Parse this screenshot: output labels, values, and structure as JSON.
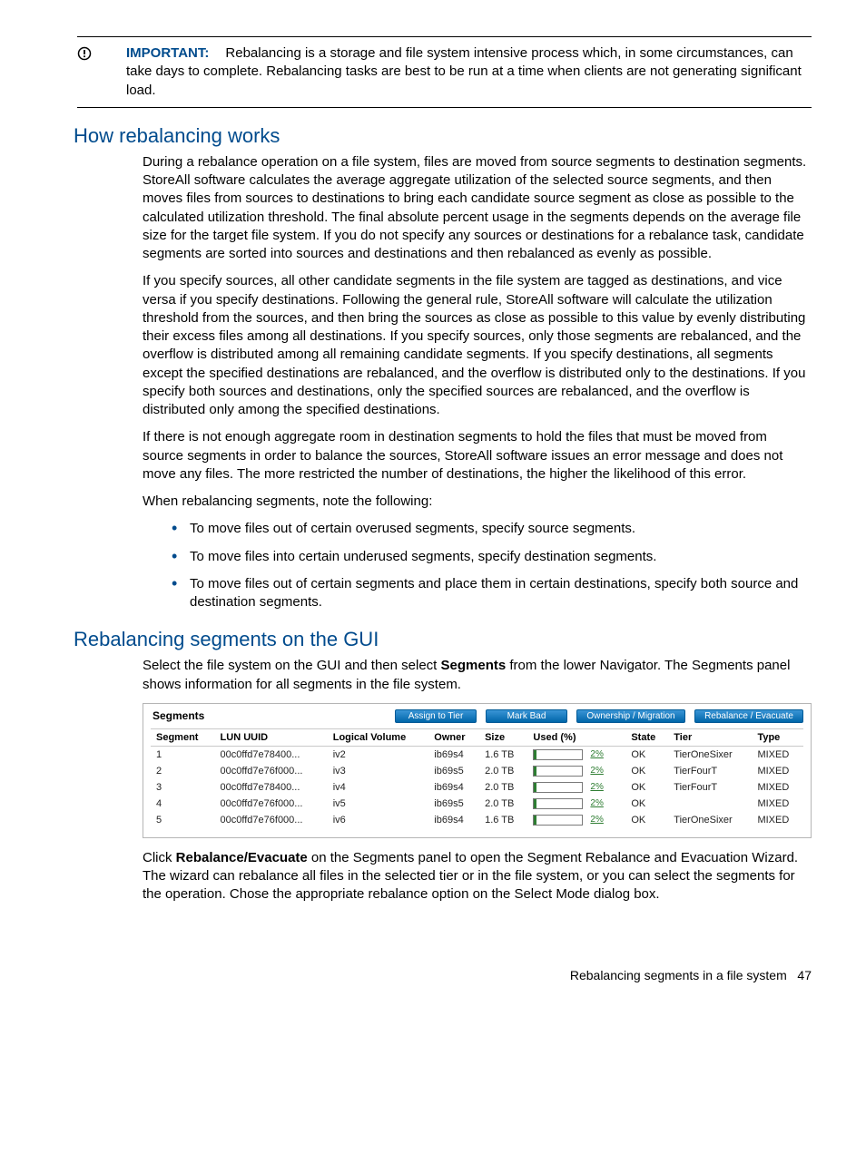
{
  "important": {
    "label": "IMPORTANT:",
    "text": "Rebalancing is a storage and file system intensive process which, in some circumstances, can take days to complete. Rebalancing tasks are best to be run at a time when clients are not generating significant load."
  },
  "section1": {
    "heading": "How rebalancing works",
    "p1": "During a rebalance operation on a file system, files are moved from source segments to destination segments. StoreAll software calculates the average aggregate utilization of the selected source segments, and then moves files from sources to destinations to bring each candidate source segment as close as possible to the calculated utilization threshold. The final absolute percent usage in the segments depends on the average file size for the target file system. If you do not specify any sources or destinations for a rebalance task, candidate segments are sorted into sources and destinations and then rebalanced as evenly as possible.",
    "p2": "If you specify sources, all other candidate segments in the file system are tagged as destinations, and vice versa if you specify destinations. Following the general rule, StoreAll software will calculate the utilization threshold from the sources, and then bring the sources as close as possible to this value by evenly distributing their excess files among all destinations. If you specify sources, only those segments are rebalanced, and the overflow is distributed among all remaining candidate segments. If you specify destinations, all segments except the specified destinations are rebalanced, and the overflow is distributed only to the destinations. If you specify both sources and destinations, only the specified sources are rebalanced, and the overflow is distributed only among the specified destinations.",
    "p3": "If there is not enough aggregate room in destination segments to hold the files that must be moved from source segments in order to balance the sources, StoreAll software issues an error message and does not move any files. The more restricted the number of destinations, the higher the likelihood of this error.",
    "p4": "When rebalancing segments, note the following:",
    "bullets": [
      "To move files out of certain overused segments, specify source segments.",
      "To move files into certain underused segments, specify destination segments.",
      "To move files out of certain segments and place them in certain destinations, specify both source and destination segments."
    ]
  },
  "section2": {
    "heading": "Rebalancing segments on the GUI",
    "p1_pre": "Select the file system on the GUI and then select ",
    "p1_bold": "Segments",
    "p1_post": " from the lower Navigator. The Segments panel shows information for all segments in the file system.",
    "p2_pre": "Click ",
    "p2_bold": "Rebalance/Evacuate",
    "p2_post": " on the Segments panel to open the Segment Rebalance and Evacuation Wizard. The wizard can rebalance all files in the selected tier or in the file system, or you can select the segments for the operation. Chose the appropriate rebalance option on the Select Mode dialog box."
  },
  "panel": {
    "title": "Segments",
    "buttons": [
      "Assign to Tier",
      "Mark Bad",
      "Ownership / Migration",
      "Rebalance / Evacuate"
    ],
    "columns": [
      "Segment",
      "LUN UUID",
      "Logical Volume",
      "Owner",
      "Size",
      "Used (%)",
      "State",
      "Tier",
      "Type"
    ],
    "rows": [
      {
        "segment": "1",
        "lun": "00c0ffd7e78400...",
        "lvol": "iv2",
        "owner": "ib69s4",
        "size": "1.6 TB",
        "used": "2%",
        "state": "OK",
        "tier": "TierOneSixer",
        "type": "MIXED"
      },
      {
        "segment": "2",
        "lun": "00c0ffd7e76f000...",
        "lvol": "iv3",
        "owner": "ib69s5",
        "size": "2.0 TB",
        "used": "2%",
        "state": "OK",
        "tier": "TierFourT",
        "type": "MIXED"
      },
      {
        "segment": "3",
        "lun": "00c0ffd7e78400...",
        "lvol": "iv4",
        "owner": "ib69s4",
        "size": "2.0 TB",
        "used": "2%",
        "state": "OK",
        "tier": "TierFourT",
        "type": "MIXED"
      },
      {
        "segment": "4",
        "lun": "00c0ffd7e76f000...",
        "lvol": "iv5",
        "owner": "ib69s5",
        "size": "2.0 TB",
        "used": "2%",
        "state": "OK",
        "tier": "",
        "type": "MIXED"
      },
      {
        "segment": "5",
        "lun": "00c0ffd7e76f000...",
        "lvol": "iv6",
        "owner": "ib69s4",
        "size": "1.6 TB",
        "used": "2%",
        "state": "OK",
        "tier": "TierOneSixer",
        "type": "MIXED"
      }
    ]
  },
  "footer": {
    "text": "Rebalancing segments in a file system",
    "page": "47"
  }
}
